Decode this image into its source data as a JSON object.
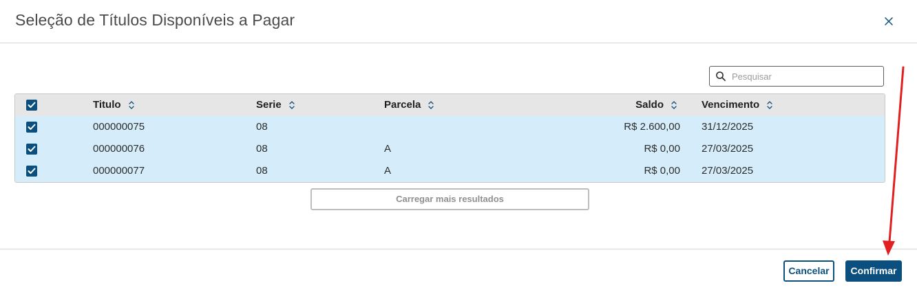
{
  "dialog": {
    "title": "Seleção de Títulos Disponíveis a Pagar",
    "close_icon": "close-icon"
  },
  "search": {
    "placeholder": "Pesquisar",
    "value": "",
    "icon": "search-icon"
  },
  "table": {
    "select_all_checked": true,
    "columns": [
      {
        "key": "titulo",
        "label": "Titulo",
        "sortable": true
      },
      {
        "key": "serie",
        "label": "Serie",
        "sortable": true
      },
      {
        "key": "parcela",
        "label": "Parcela",
        "sortable": true
      },
      {
        "key": "saldo",
        "label": "Saldo",
        "sortable": true
      },
      {
        "key": "vencimento",
        "label": "Vencimento",
        "sortable": true
      }
    ],
    "rows": [
      {
        "checked": true,
        "titulo": "000000075",
        "serie": "08",
        "parcela": "",
        "saldo": "R$ 2.600,00",
        "vencimento": "31/12/2025"
      },
      {
        "checked": true,
        "titulo": "000000076",
        "serie": "08",
        "parcela": "A",
        "saldo": "R$ 0,00",
        "vencimento": "27/03/2025"
      },
      {
        "checked": true,
        "titulo": "000000077",
        "serie": "08",
        "parcela": "A",
        "saldo": "R$ 0,00",
        "vencimento": "27/03/2025"
      }
    ]
  },
  "load_more": {
    "label": "Carregar mais resultados"
  },
  "footer": {
    "cancel_label": "Cancelar",
    "confirm_label": "Confirmar"
  },
  "colors": {
    "primary": "#0b4f7e",
    "selected_row": "#d5ecfa",
    "header_bg": "#e6e6e6",
    "annotation_arrow": "#e02020"
  }
}
